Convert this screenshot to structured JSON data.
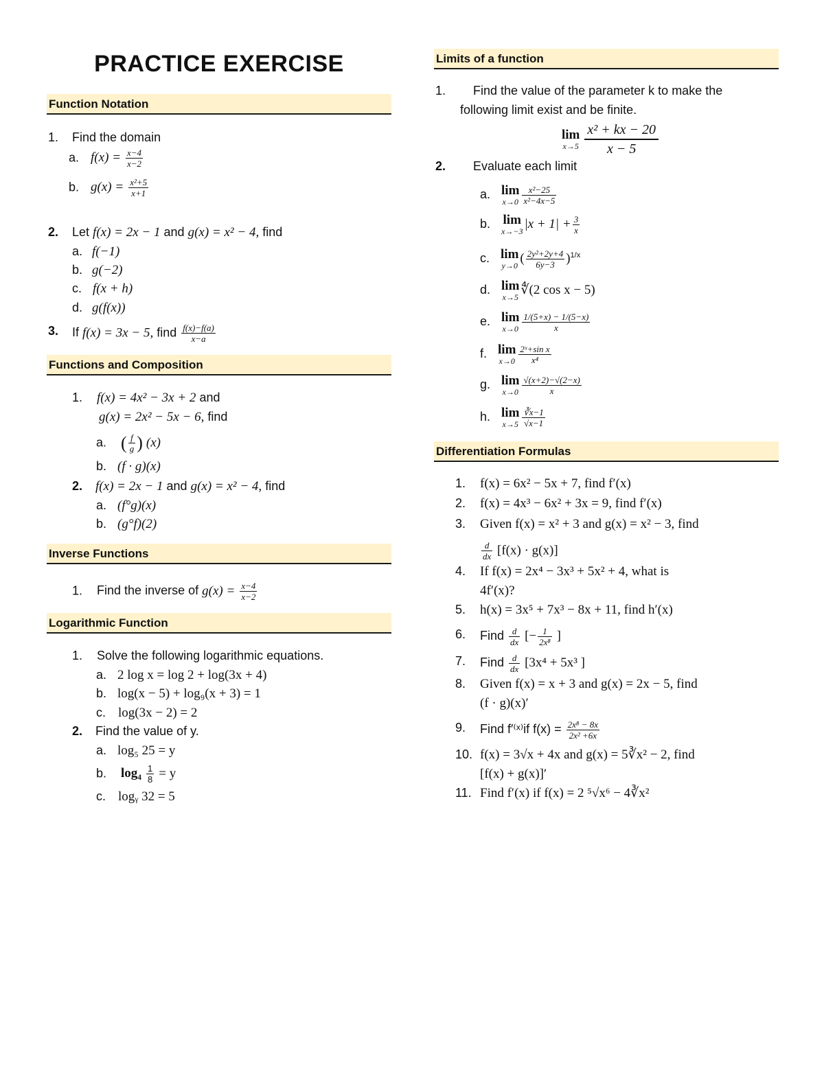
{
  "title": "PRACTICE EXERCISE",
  "left": {
    "function_notation": {
      "heading": "Function Notation",
      "q1": {
        "num": "1.",
        "text": "Find the domain",
        "a": {
          "label": "a.",
          "lhs": "f(x) =",
          "num": "x−4",
          "den": "x−2"
        },
        "b": {
          "label": "b.",
          "lhs": "g(x) =",
          "num": "x²+5",
          "den": "x+1"
        }
      },
      "q2": {
        "num": "2.",
        "text_pre": "Let",
        "f": "f(x) = 2x − 1",
        "and": "and",
        "g": "g(x) = x² − 4,",
        "find": "find",
        "items": [
          {
            "label": "a.",
            "expr": "f(−1)"
          },
          {
            "label": "b.",
            "expr": "g(−2)"
          },
          {
            "label": "c.",
            "expr": "f(x + h)"
          },
          {
            "label": "d.",
            "expr": "g(f(x))"
          }
        ]
      },
      "q3": {
        "num": "3.",
        "text_pre": "If",
        "f": "f(x) = 3x − 5,",
        "find": "find",
        "num_expr": "f(x)−f(a)",
        "den_expr": "x−a"
      }
    },
    "composition": {
      "heading": "Functions and Composition",
      "q1": {
        "num": "1.",
        "line1": "f(x) = 4x² − 3x + 2",
        "and": "and",
        "line2": "g(x) = 2x² − 5x − 6,",
        "find": "find",
        "a": {
          "label": "a.",
          "frac_n": "f",
          "frac_d": "g",
          "rest": "(x)"
        },
        "b": {
          "label": "b.",
          "expr": "(f · g)(x)"
        }
      },
      "q2": {
        "num": "2.",
        "f": "f(x) = 2x − 1",
        "and": "and",
        "g": "g(x) = x² − 4,",
        "find": "find",
        "a": {
          "label": "a.",
          "expr": "(f°g)(x)"
        },
        "b": {
          "label": "b.",
          "expr": "(g°f)(2)"
        }
      }
    },
    "inverse": {
      "heading": "Inverse Functions",
      "q1": {
        "num": "1.",
        "text": "Find the inverse of",
        "lhs": "g(x) =",
        "num_expr": "x−4",
        "den_expr": "x−2"
      }
    },
    "log": {
      "heading": "Logarithmic Function",
      "q1": {
        "num": "1.",
        "text": "Solve the following logarithmic equations.",
        "items": [
          {
            "label": "a.",
            "expr": "2 log x = log 2 + log(3x + 4)"
          },
          {
            "label": "b.",
            "expr": "log(x − 5) + log₉(x + 3) = 1"
          },
          {
            "label": "c.",
            "expr": "log(3x − 2) = 2"
          }
        ]
      },
      "q2": {
        "num": "2.",
        "text": "Find the value of y.",
        "a": {
          "label": "a.",
          "expr": "log₅ 25 = y"
        },
        "b": {
          "label": "b.",
          "pre": "log₄",
          "n": "1",
          "d": "8",
          "post": "= y"
        },
        "c": {
          "label": "c.",
          "expr": "logᵧ 32 = 5"
        }
      }
    }
  },
  "right": {
    "limits": {
      "heading": "Limits of a function",
      "q1": {
        "num": "1.",
        "line1": "Find the value of the parameter k to make the",
        "line2": "following limit exist and be finite.",
        "lim": "lim",
        "sub": "x→5",
        "num_expr": "x² + kx − 20",
        "den_expr": "x − 5"
      },
      "q2": {
        "num": "2.",
        "text": "Evaluate each limit",
        "items": [
          {
            "label": "a.",
            "sub": "x→0",
            "num": "x²−25",
            "den": "x²−4x−5"
          },
          {
            "label": "b.",
            "sub": "x→−3",
            "expr": "|x + 1| +",
            "num": "3",
            "den": "x"
          },
          {
            "label": "c.",
            "sub": "y→0",
            "num": "2y²+2y+4",
            "den": "6y−3",
            "exp": "1/x"
          },
          {
            "label": "d.",
            "sub": "x→5",
            "expr": "∜(2 cos x − 5)"
          },
          {
            "label": "e.",
            "sub": "x→0",
            "num": "1/(5+x) − 1/(5−x)",
            "den": "x"
          },
          {
            "label": "f.",
            "sub": "x→0",
            "num": "2ˣ+sin x",
            "den": "x⁴"
          },
          {
            "label": "g.",
            "sub": "x→0",
            "num": "√(x+2)−√(2−x)",
            "den": "x"
          },
          {
            "label": "h.",
            "sub": "x→5",
            "num": "∛x−1",
            "den": "√x−1"
          }
        ],
        "lim": "lim"
      }
    },
    "diff": {
      "heading": "Differentiation Formulas",
      "items": [
        {
          "num": "1.",
          "text": "f(x) = 6x² − 5x + 7, find f′(x)"
        },
        {
          "num": "2.",
          "text": "f(x) = 4x³ − 6x² + 3x = 9, find f′(x)"
        },
        {
          "num": "3.",
          "text": "Given f(x) =  x²  + 3 and g(x)  =  x² − 3, find",
          "cont": "[f(x) · g(x)]",
          "d": "d",
          "dx": "dx"
        },
        {
          "num": "4.",
          "text": "If f(x)  =  2x⁴  −  3x³  +  5x²  +  4, what is",
          "cont": "4f′(x)?"
        },
        {
          "num": "5.",
          "text": "h(x) = 3x⁵ + 7x³ − 8x + 11, find h′(x)"
        },
        {
          "num": "6.",
          "pre": "Find",
          "d": "d",
          "dx": "dx",
          "post_pre": "[−",
          "n": "1",
          "den": "2x⁸",
          "post": "]"
        },
        {
          "num": "7.",
          "pre": "Find",
          "d": "d",
          "dx": "dx",
          "post": "[3x⁴ + 5x³ ]"
        },
        {
          "num": "8.",
          "text": "Given f(x) = x + 3 and g(x) = 2x − 5, find",
          "cont": "(f · g)(x)′"
        },
        {
          "num": "9.",
          "pre": "Find f′⁽ˣ⁾if f(x) =",
          "n": "2x⁸ − 8x",
          "den": "2x² +6x"
        },
        {
          "num": "10.",
          "text": "f(x) = 3√x  + 4x and g(x) = 5∛x² − 2, find",
          "cont": "[f(x)  +  g(x)]′"
        },
        {
          "num": "11.",
          "text": "Find f′(x) if f(x) = 2 ⁵√x⁶ − 4∛x²"
        }
      ]
    }
  },
  "colors": {
    "section_bg": "#fff2cc",
    "rule": "#1a1a1a"
  }
}
